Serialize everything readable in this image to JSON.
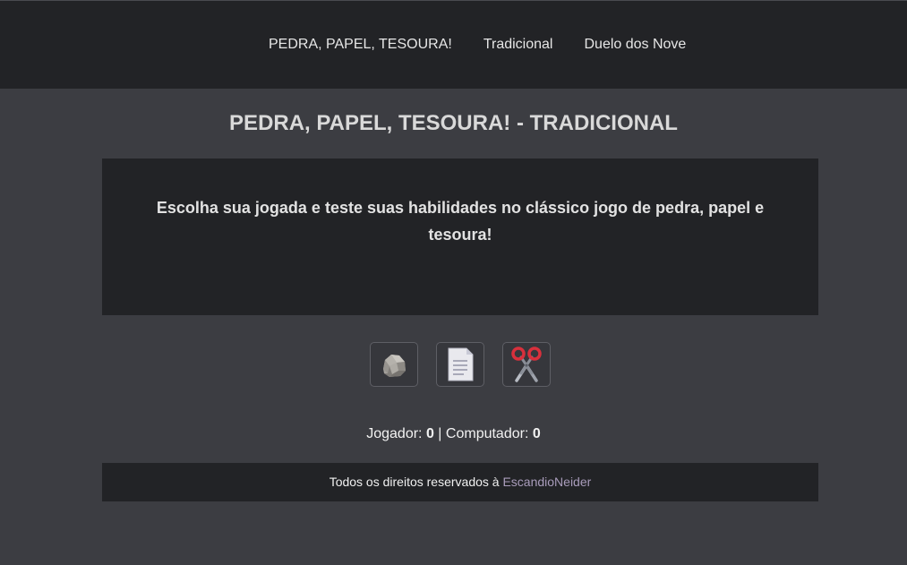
{
  "nav": {
    "brand": "PEDRA, PAPEL, TESOURA!",
    "items": [
      "Tradicional",
      "Duelo dos Nove"
    ]
  },
  "page": {
    "title": "PEDRA, PAPEL, TESOURA! - TRADICIONAL",
    "intro": "Escolha sua jogada e teste suas habilidades no clássico jogo de pedra, papel e tesoura!"
  },
  "choices": [
    {
      "icon": "rock-icon",
      "value": "pedra"
    },
    {
      "icon": "paper-icon",
      "value": "papel"
    },
    {
      "icon": "scissors-icon",
      "value": "tesoura"
    }
  ],
  "score": {
    "player_label": "Jogador:",
    "player_value": "0",
    "separator": "|",
    "computer_label": "Computador:",
    "computer_value": "0"
  },
  "footer": {
    "text": "Todos os direitos reservados à",
    "author": "EscandioNeider"
  },
  "colors": {
    "background": "#3c3d42",
    "panel": "#222326",
    "link_accent": "#a99cbb"
  }
}
